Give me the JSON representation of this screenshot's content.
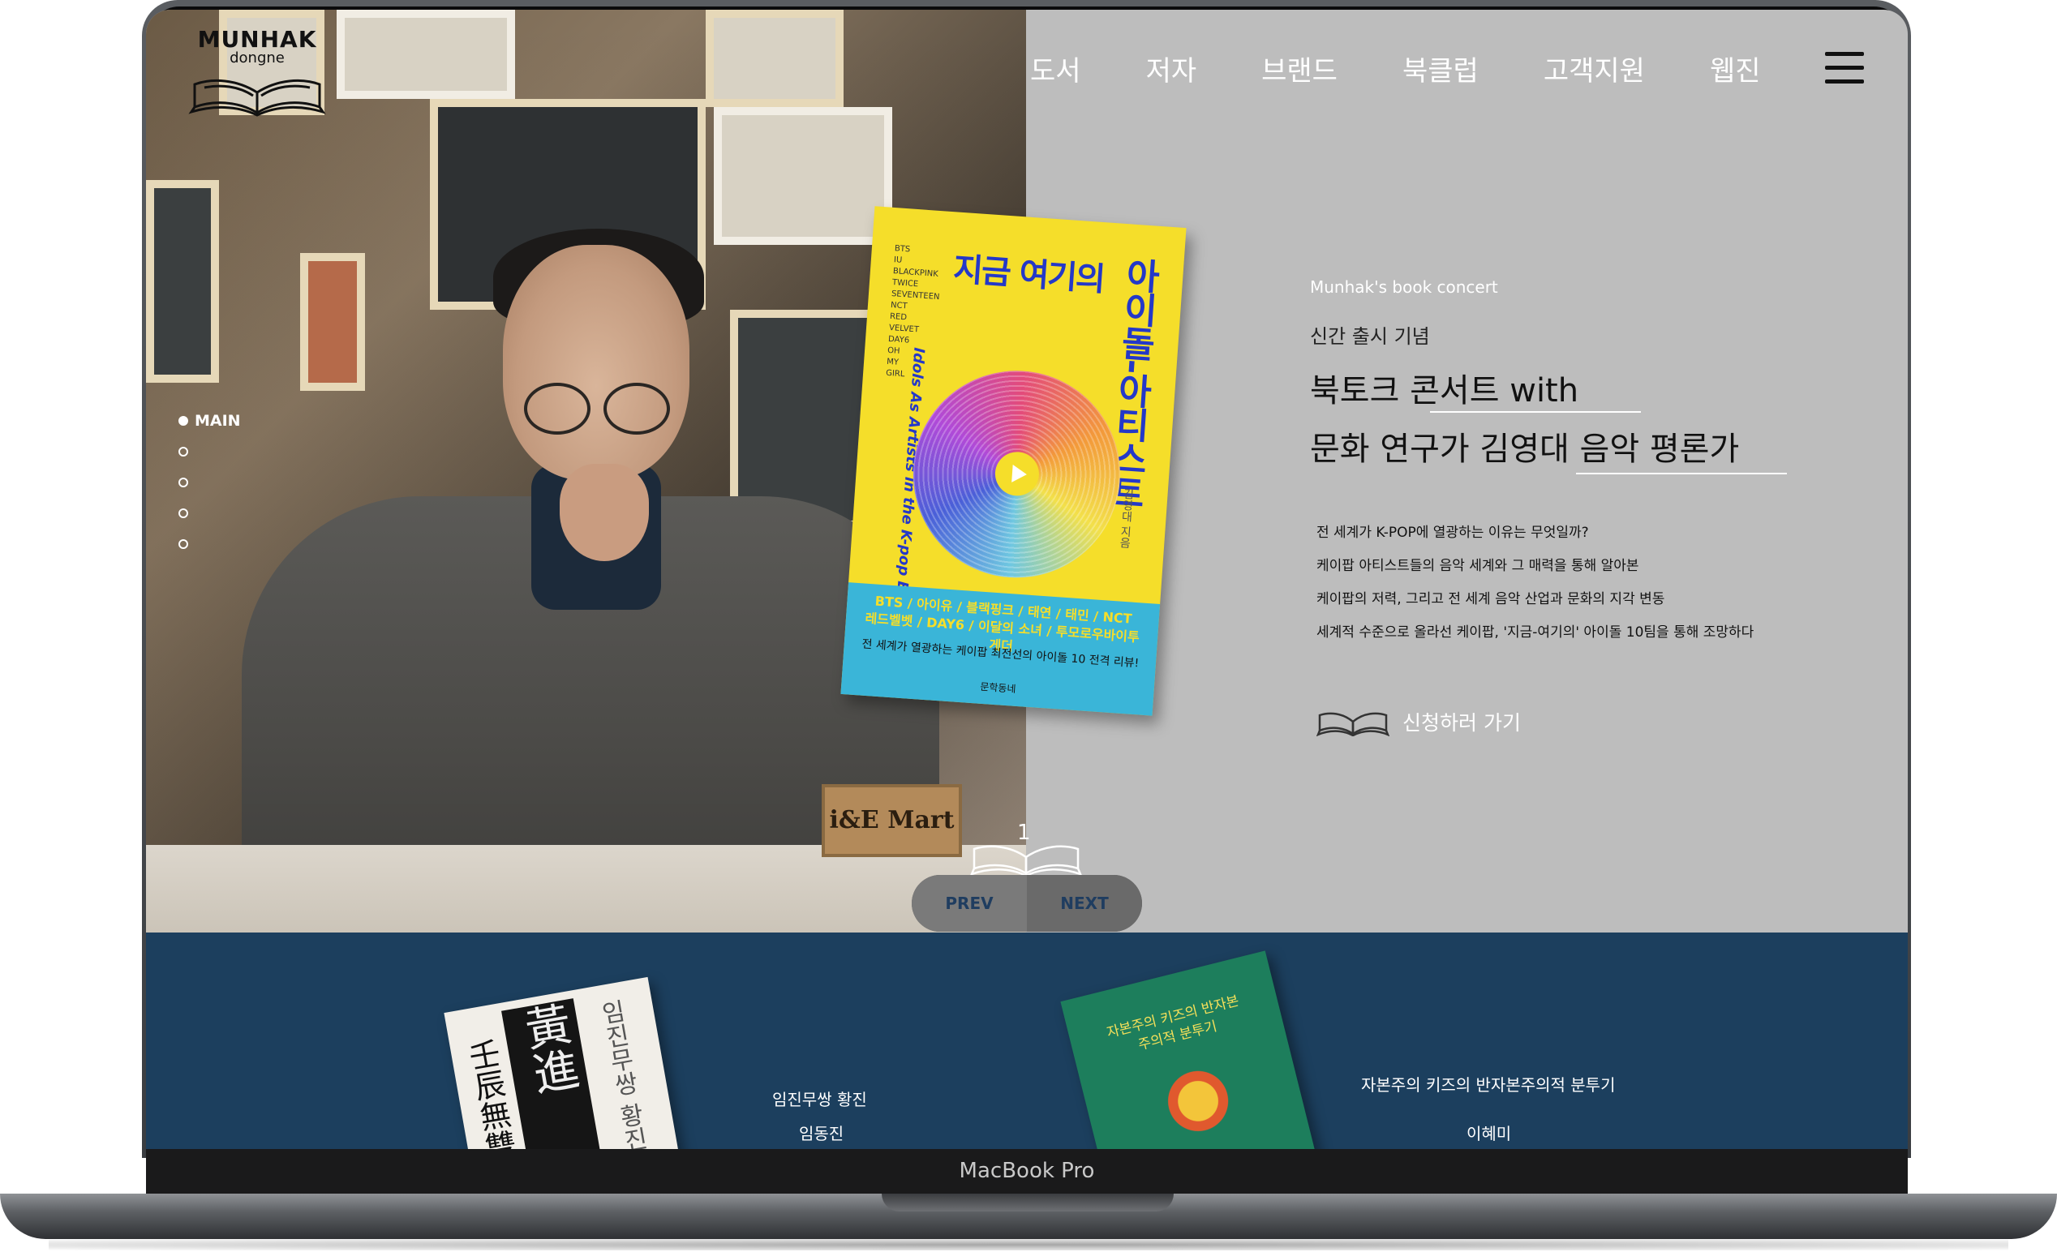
{
  "device": {
    "label": "MacBook Pro"
  },
  "logo": {
    "title": "MUNHAK",
    "subtitle": "dongne"
  },
  "nav": {
    "items": [
      {
        "label": "도서"
      },
      {
        "label": "저자"
      },
      {
        "label": "브랜드"
      },
      {
        "label": "북클럽"
      },
      {
        "label": "고객지원"
      },
      {
        "label": "웹진"
      }
    ]
  },
  "side_nav": {
    "active_label": "MAIN",
    "dot_count": 5,
    "active_index": 0
  },
  "hero": {
    "photo_prop_text": "i&E Mart",
    "book": {
      "small_list": "BTS IU BLACKPINK TWICE SEVENTEEN NCT RED VELVET DAY6 OH MY GIRL",
      "title_horizontal": "지금 여기의",
      "title_vertical": "아이돌-아티스트",
      "subtitle": "Idols As Artists in the K-pop Era",
      "author": "김영대 지음",
      "band_line1": "BTS / 아이유 / 블랙핑크 / 태연 / 태민 / NCT",
      "band_line1b": "레드벨벳 / DAY6 / 이달의 소녀 / 투모로우바이투게더",
      "band_line2": "전 세계가 열광하는 케이팝 최전선의 아이돌 10 전격 리뷰!",
      "publisher": "문학동네"
    }
  },
  "event": {
    "label_en": "Munhak's book concert",
    "tag": "신간 출시 기념",
    "title_line1": "북토크 콘서트 with",
    "title_line2": "문화 연구가 김영대 음악 평론가",
    "description": [
      "전 세계가  K-POP에 열광하는 이유는 무엇일까?",
      "케이팝 아티스트들의 음악 세계와 그 매력을 통해 알아본",
      "케이팝의 저력, 그리고 전 세계 음악 산업과 문화의 지각 변동",
      "세계적 수준으로 올라선 케이팝, '지금-여기의' 아이돌 10팀을 통해 조망하다"
    ],
    "cta_label": "신청하러 가기"
  },
  "pager": {
    "current": "1",
    "prev_label": "PREV",
    "next_label": "NEXT"
  },
  "lower_books": [
    {
      "title": "임진무쌍 황진",
      "author": "임동진",
      "cover_title": "黃進",
      "cover_sub": "壬辰無雙",
      "cover_side": "임진무쌍 황진"
    },
    {
      "title": "자본주의 키즈의 반자본주의적 분투기",
      "author": "이혜미",
      "cover_title": "자본주의 키즈의 반자본주의적 분투기"
    }
  ],
  "colors": {
    "hero_right_bg": "#bdbdbd",
    "lower_band_bg": "#1c3f5e",
    "book_yellow": "#f5de2a",
    "book_blue_text": "#2438c8",
    "book_band": "#3ab5d8",
    "pager_text": "#1f3d60"
  },
  "icons": {
    "logo": "open-book-icon",
    "cta": "open-book-icon",
    "menu": "hamburger-menu-icon",
    "play": "play-icon"
  }
}
